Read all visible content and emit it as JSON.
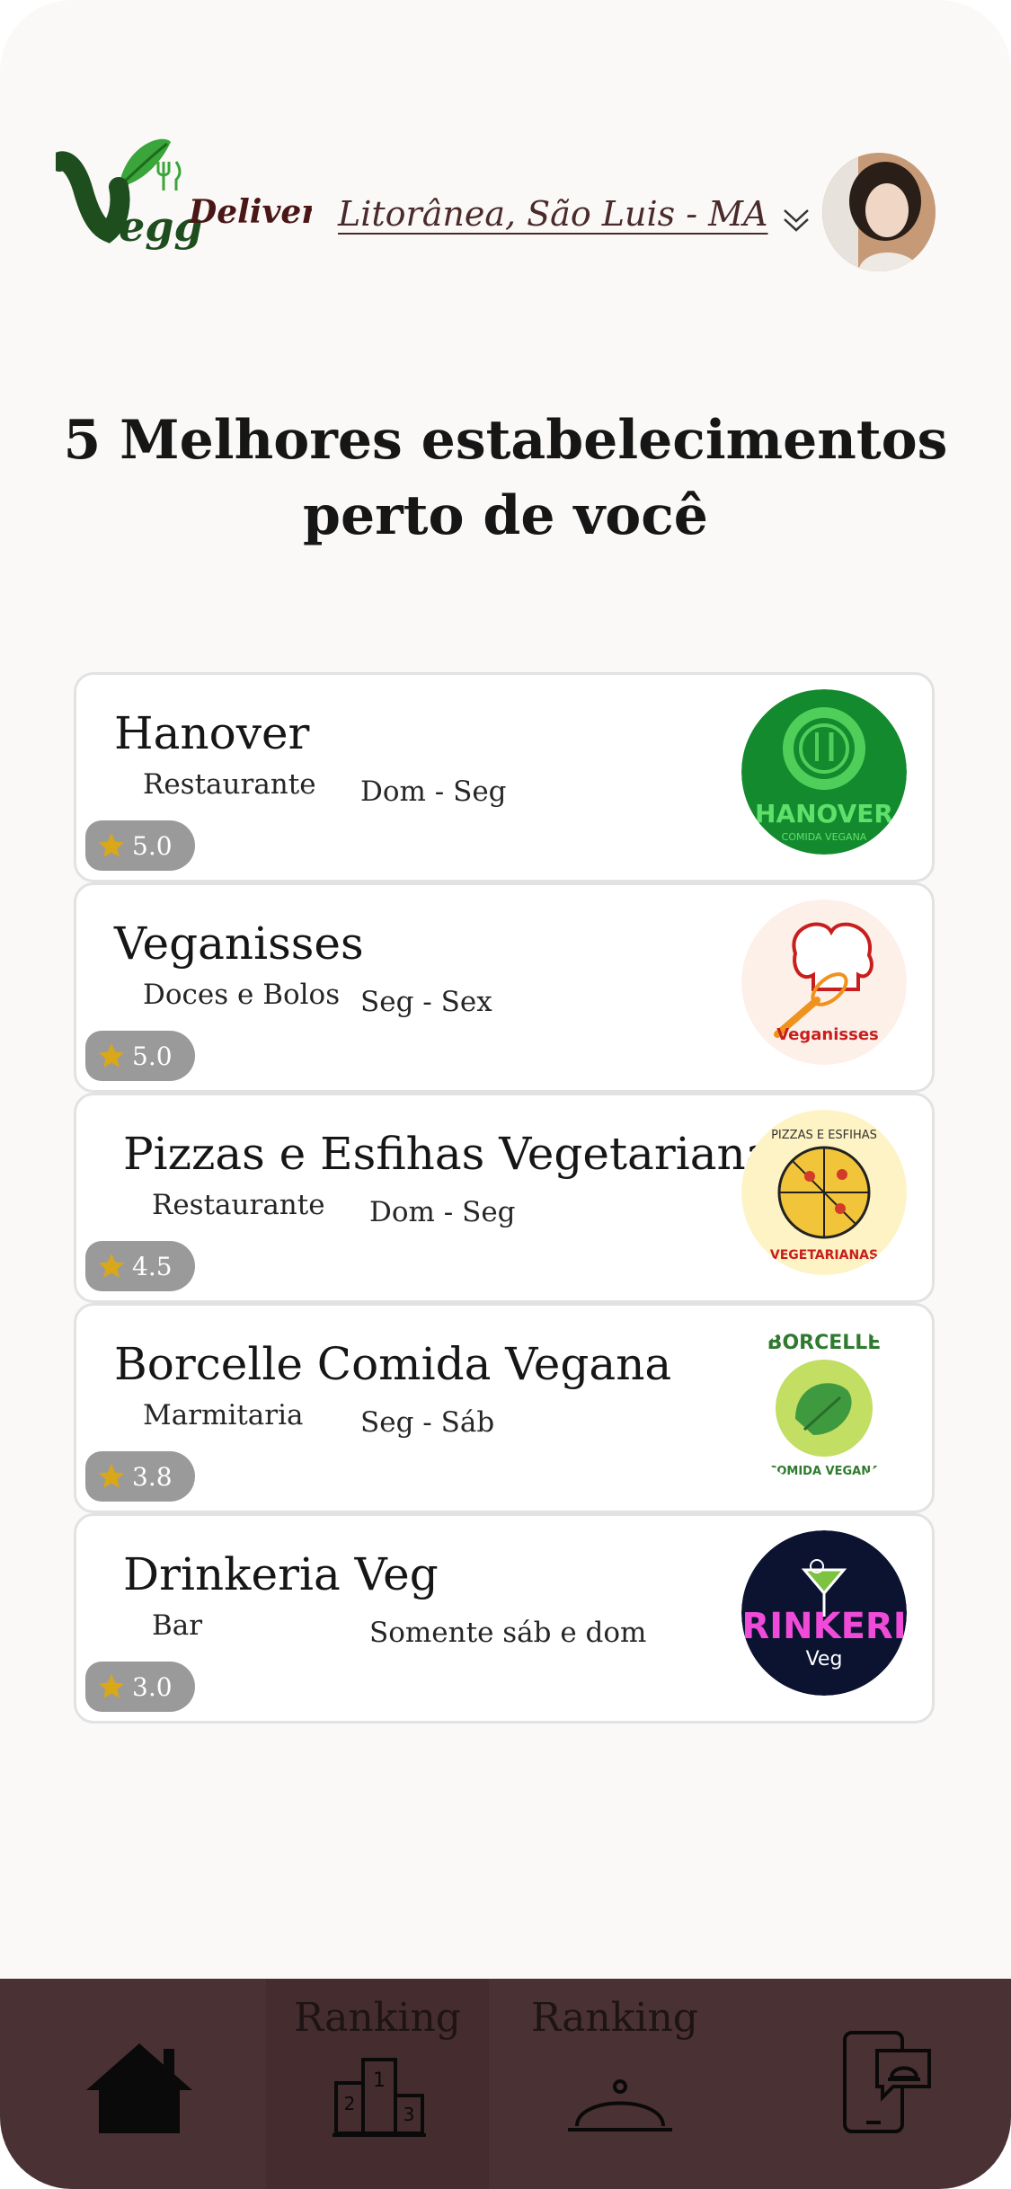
{
  "header": {
    "logo_text": "VeggDelivery",
    "location": "Litorânea, São Luis - MA"
  },
  "title": {
    "line1": "5 Melhores estabelecimentos",
    "line2": "perto de você"
  },
  "restaurants": [
    {
      "name": "Hanover",
      "type": "Restaurante",
      "days": "Dom - Seg",
      "rating": "5.0",
      "logo_text": "HANOVER",
      "logo_sub": "COMIDA VEGANA"
    },
    {
      "name": "Veganisses",
      "type": "Doces e Bolos",
      "days": "Seg - Sex",
      "rating": "5.0",
      "logo_text": "Veganisses"
    },
    {
      "name": "Pizzas e Esfihas Vegetarianas",
      "type": "Restaurante",
      "days": "Dom - Seg",
      "rating": "4.5",
      "logo_text": "PIZZAS E ESFIHAS",
      "logo_sub": "VEGETARIANAS"
    },
    {
      "name": "Borcelle Comida Vegana",
      "type": "Marmitaria",
      "days": "Seg - Sáb",
      "rating": "3.8",
      "logo_text": "BORCELLE",
      "logo_sub": "COMIDA VEGANA"
    },
    {
      "name": "Drinkeria Veg",
      "type": "Bar",
      "days": "Somente sáb e dom",
      "rating": "3.0",
      "logo_text": "RINKERI",
      "logo_sub": "Veg"
    }
  ],
  "nav": {
    "home_icon": "home-icon",
    "ranking_label_1": "Ranking",
    "ranking_label_2": "Ranking",
    "podium_icon": "podium-icon",
    "cloche_icon": "cloche-icon",
    "orders_icon": "phone-order-icon"
  },
  "colors": {
    "background": "#faf9f7",
    "nav": "#4a3133",
    "rating_badge": "#9a9a9a",
    "star": "#d8a818",
    "brand_green": "#1d5a1d"
  }
}
